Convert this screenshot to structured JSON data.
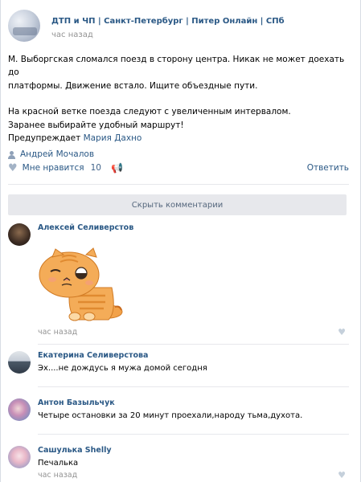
{
  "post": {
    "group_name": "ДТП и ЧП | Санкт-Петербург | Питер Онлайн | СПб",
    "time": "час назад",
    "lines": [
      "М. Выборгская сломался поезд в сторону центра. Никак не может доехать до",
      "платформы. Движение встало. Ищите объездные пути."
    ],
    "lines2": [
      "На красной ветке поезда следуют с увеличенным интервалом.",
      "Заранее выбирайте удобный маршрут!"
    ],
    "warns_prefix": "Предупреждает",
    "warns_name": "Мария Дахно",
    "signer": "Андрей Мочалов"
  },
  "actions": {
    "like_label": "Мне нравится",
    "like_count": "10",
    "reply_label": "Ответить"
  },
  "hide_comments_label": "Скрыть комментарии",
  "comments": [
    {
      "author": "Алексей Селиверстов",
      "text": "",
      "time": "час назад",
      "sticker": "sad-cat-sticker"
    },
    {
      "author": "Екатерина Селиверстова",
      "text": "Эх....не дождусь я мужа домой сегодня",
      "time": "",
      "sticker": ""
    },
    {
      "author": "Антон Базыльчук",
      "text": "Четыре остановки за 20 минут проехали,народу тьма,духота.",
      "time": "",
      "sticker": ""
    },
    {
      "author": "Сашулька Shelly",
      "text": "Печалька",
      "time": "час назад",
      "sticker": ""
    }
  ],
  "colors": {
    "link": "#2a5885",
    "muted": "#939393",
    "button_bg": "#e7e8ec"
  }
}
